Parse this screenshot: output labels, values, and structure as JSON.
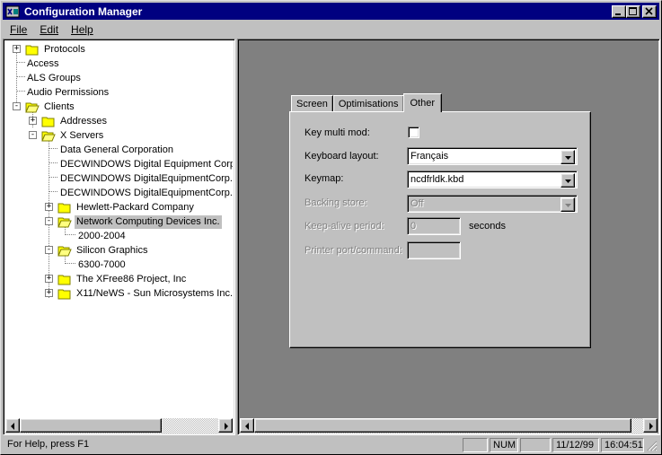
{
  "window": {
    "title": "Configuration Manager",
    "title_bar_color": "#000080",
    "app_icon": "configuration-manager-icon"
  },
  "menu": {
    "file": "File",
    "edit": "Edit",
    "help": "Help"
  },
  "tree": {
    "nodes": [
      {
        "label": "Protocols",
        "icon": "folder-icon",
        "expander": "+"
      },
      {
        "label": "Access"
      },
      {
        "label": "ALS Groups"
      },
      {
        "label": "Audio Permissions"
      },
      {
        "label": "Clients",
        "icon": "folder-open-icon",
        "expander": "-"
      },
      {
        "label": "Addresses",
        "icon": "folder-icon",
        "expander": "+"
      },
      {
        "label": "X Servers",
        "icon": "folder-open-icon",
        "expander": "-"
      },
      {
        "label": "Data General Corporation"
      },
      {
        "label": "DECWINDOWS Digital Equipment Corpo"
      },
      {
        "label": "DECWINDOWS DigitalEquipmentCorp."
      },
      {
        "label": "DECWINDOWS DigitalEquipmentCorp. A"
      },
      {
        "label": "Hewlett-Packard Company",
        "icon": "folder-icon",
        "expander": "+"
      },
      {
        "label": "Network Computing Devices Inc.",
        "icon": "folder-open-icon",
        "expander": "-",
        "selected": true
      },
      {
        "label": "2000-2004"
      },
      {
        "label": "Silicon Graphics",
        "icon": "folder-open-icon",
        "expander": "-"
      },
      {
        "label": "6300-7000"
      },
      {
        "label": "The XFree86 Project, Inc",
        "icon": "folder-icon",
        "expander": "+"
      },
      {
        "label": "X11/NeWS - Sun Microsystems Inc.",
        "icon": "folder-icon",
        "expander": "+"
      }
    ]
  },
  "tabs": [
    {
      "label": "Screen"
    },
    {
      "label": "Optimisations"
    },
    {
      "label": "Other",
      "active": true
    }
  ],
  "form": {
    "key_multi_mod": {
      "label": "Key multi mod:",
      "checked": false
    },
    "keyboard_layout": {
      "label": "Keyboard layout:",
      "value": "Français"
    },
    "keymap": {
      "label": "Keymap:",
      "value": "ncdfrldk.kbd"
    },
    "backing_store": {
      "label": "Backing store:",
      "value": "Off",
      "disabled": true
    },
    "keep_alive": {
      "label": "Keep-alive period:",
      "value": "0",
      "unit": "seconds",
      "disabled": true
    },
    "printer_port": {
      "label": "Printer port/command:",
      "value": "",
      "disabled": true
    }
  },
  "status": {
    "help": "For Help, press F1",
    "caps": "",
    "num": "NUM",
    "scrl": "",
    "date": "11/12/99",
    "time": "16:04:51"
  }
}
